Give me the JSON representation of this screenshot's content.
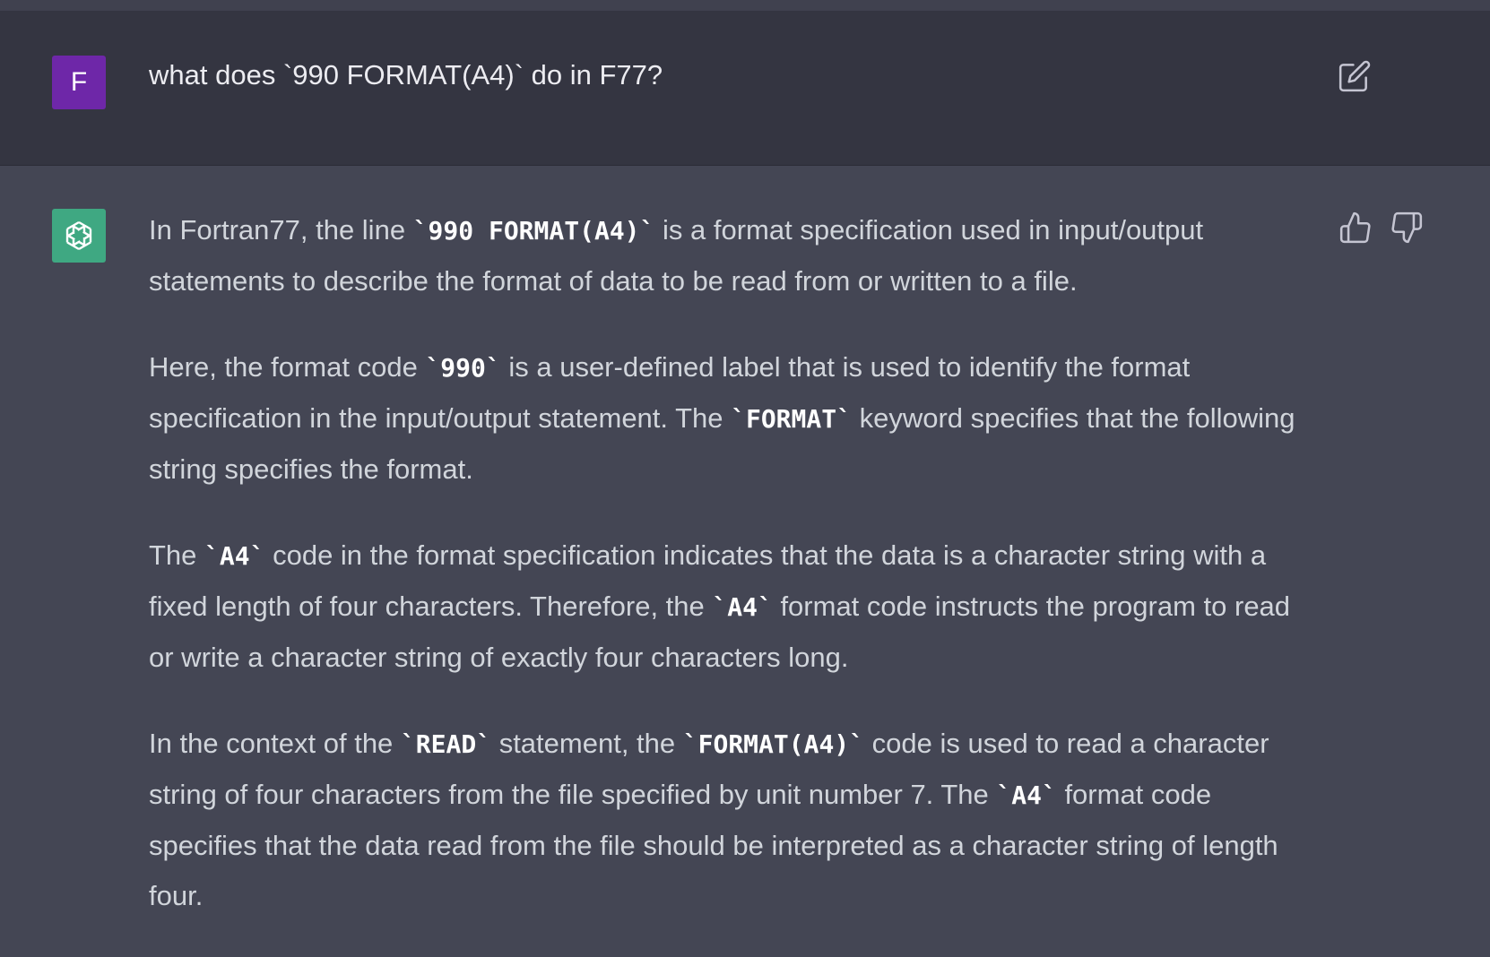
{
  "user": {
    "avatar_letter": "F",
    "avatar_color": "#6e27a8",
    "message": "what does `990 FORMAT(A4)` do in F77?",
    "edit_icon": "edit-icon"
  },
  "assistant": {
    "avatar_icon": "openai-logo-icon",
    "avatar_color": "#3fa882",
    "feedback": {
      "like_icon": "thumbs-up-icon",
      "dislike_icon": "thumbs-down-icon"
    },
    "paragraphs": [
      {
        "p1_t1": "In Fortran77, the line ",
        "p1_c1": "`990 FORMAT(A4)`",
        "p1_t2": " is a format specification used in input/output statements to describe the format of data to be read from or written to a file."
      }
    ],
    "p1": {
      "t1": "In Fortran77, the line ",
      "c1": "`990 FORMAT(A4)`",
      "t2": " is a format specification used in input/output statements to describe the format of data to be read from or written to a file."
    },
    "p2": {
      "t1": "Here, the format code ",
      "c1": "`990`",
      "t2": " is a user-defined label that is used to identify the format specification in the input/output statement. The ",
      "c2": "`FORMAT`",
      "t3": " keyword specifies that the following string specifies the format."
    },
    "p3": {
      "t1": "The ",
      "c1": "`A4`",
      "t2": " code in the format specification indicates that the data is a character string with a fixed length of four characters. Therefore, the ",
      "c2": "`A4`",
      "t3": " format code instructs the program to read or write a character string of exactly four characters long."
    },
    "p4": {
      "t1": "In the context of the ",
      "c1": "`READ`",
      "t2": " statement, the ",
      "c2": "`FORMAT(A4)`",
      "t3": " code is used to read a character string of four characters from the file specified by unit number 7. The ",
      "c3": "`A4`",
      "t4": " format code specifies that the data read from the file should be interpreted as a character string of length four."
    }
  }
}
